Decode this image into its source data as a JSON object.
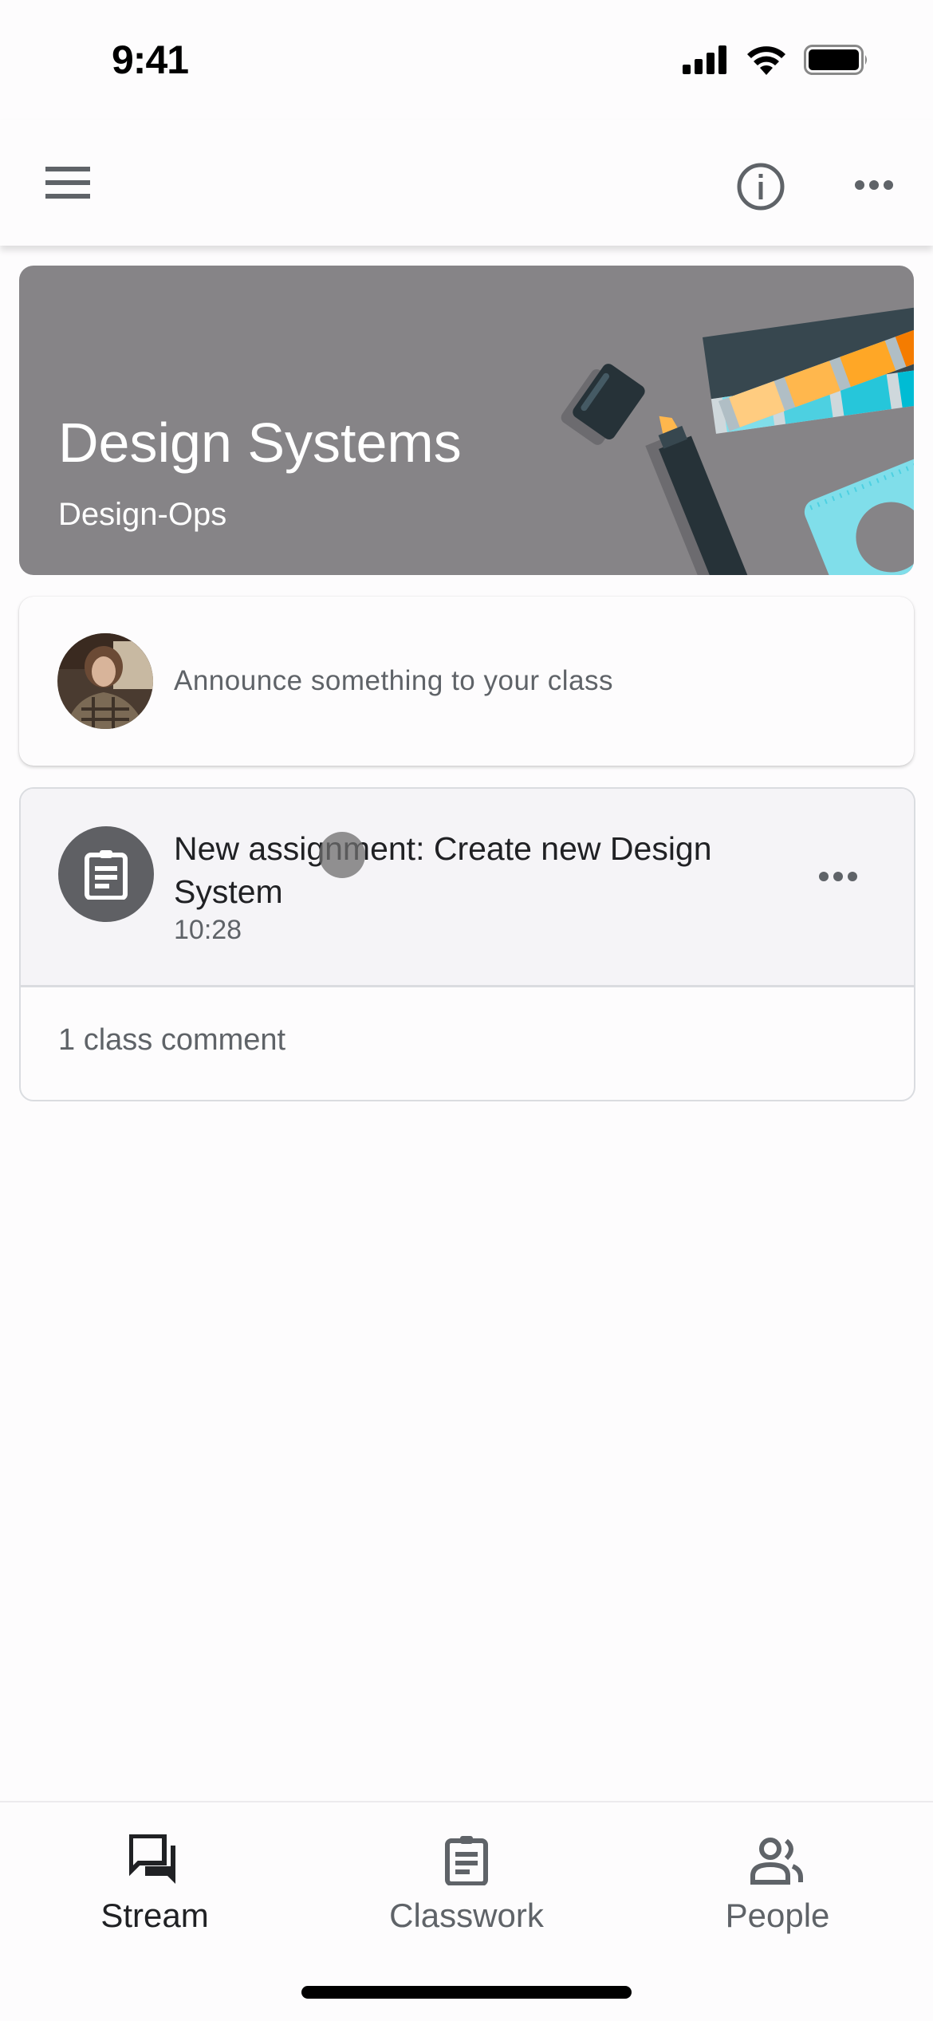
{
  "status_bar": {
    "time": "9:41",
    "icons": [
      "cellular-signal-icon",
      "wifi-icon",
      "battery-icon"
    ]
  },
  "app_bar": {
    "menu_icon": "hamburger-menu-icon",
    "info_icon": "info-icon",
    "more_icon": "more-horizontal-icon"
  },
  "class_banner": {
    "title": "Design Systems",
    "section": "Design-Ops",
    "background_color": "#868487"
  },
  "announce": {
    "placeholder": "Announce something to your class"
  },
  "posts": [
    {
      "icon": "assignment-clipboard-icon",
      "title": "New assignment: Create new Design System",
      "time": "10:28",
      "comments": "1 class comment"
    }
  ],
  "bottom_nav": {
    "items": [
      {
        "label": "Stream",
        "icon": "stream-chat-icon",
        "active": true
      },
      {
        "label": "Classwork",
        "icon": "classwork-clipboard-icon",
        "active": false
      },
      {
        "label": "People",
        "icon": "people-icon",
        "active": false
      }
    ]
  }
}
